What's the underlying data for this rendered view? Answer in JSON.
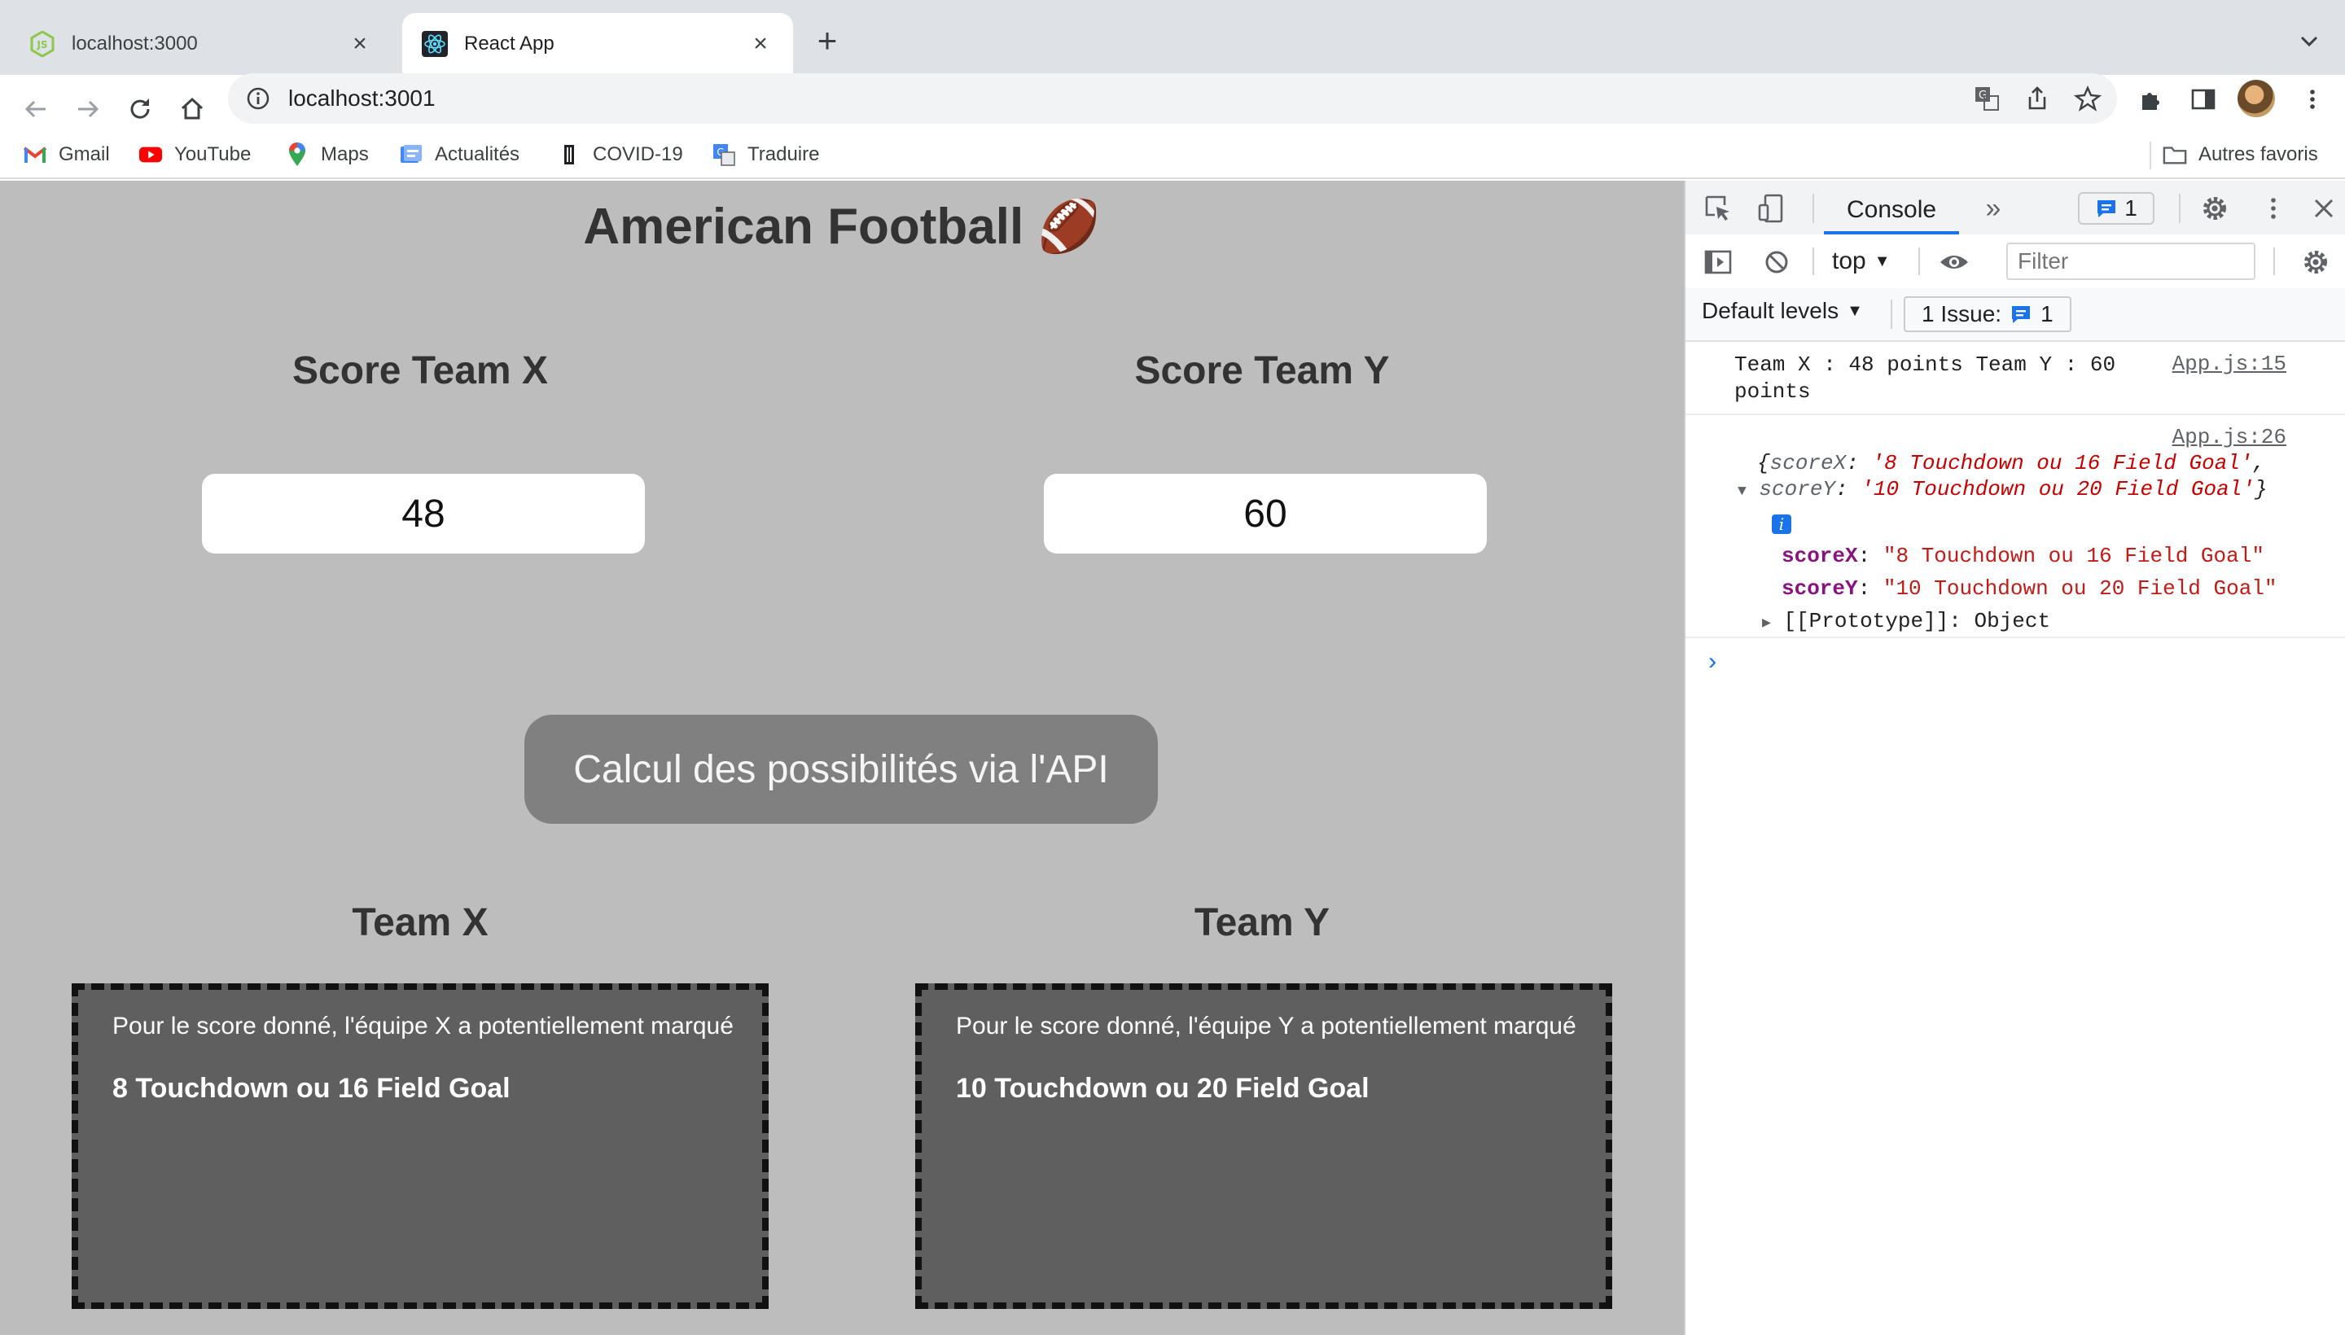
{
  "browser": {
    "tabs": [
      {
        "title": "localhost:3000",
        "icon": "nodejs-icon",
        "active": false
      },
      {
        "title": "React App",
        "icon": "react-icon",
        "active": true
      }
    ],
    "url": "localhost:3001",
    "bookmarks": [
      {
        "label": "Gmail",
        "icon": "gmail-icon"
      },
      {
        "label": "YouTube",
        "icon": "youtube-icon"
      },
      {
        "label": "Maps",
        "icon": "maps-icon"
      },
      {
        "label": "Actualités",
        "icon": "news-icon"
      },
      {
        "label": "COVID-19",
        "icon": "covid-icon"
      },
      {
        "label": "Traduire",
        "icon": "translate-icon"
      }
    ],
    "other_bookmarks": "Autres favoris"
  },
  "app": {
    "title": "American Football 🏈",
    "score_x_label": "Score Team X",
    "score_y_label": "Score Team Y",
    "score_x_value": "48",
    "score_y_value": "60",
    "button_label": "Calcul des possibilités via l'API",
    "team_x_label": "Team X",
    "team_y_label": "Team Y",
    "team_x_lead": "Pour le score donné, l'équipe X a potentiellement marqué",
    "team_y_lead": "Pour le score donné, l'équipe Y a potentiellement marqué",
    "team_x_result": "8 Touchdown ou 16 Field Goal",
    "team_y_result": "10 Touchdown ou 20 Field Goal"
  },
  "devtools": {
    "active_tab": "Console",
    "message_badge": "1",
    "context": "top",
    "filter_placeholder": "Filter",
    "levels": "Default levels",
    "issues_label": "1 Issue:",
    "issues_count": "1",
    "log1_line1": "Team X : 48 points  Team Y : 60",
    "log1_line2": "points",
    "log1_src": "App.js:15",
    "log2_src": "App.js:26",
    "obj_open": "{",
    "obj_key_x": "scoreX",
    "obj_val_x": "'8 Touchdown ou 16 Field Goal'",
    "obj_key_y": "scoreY",
    "obj_val_y": "'10 Touchdown ou 20 Field Goal'",
    "obj_close": "}",
    "prop_key_x": "scoreX",
    "prop_val_x": "\"8 Touchdown ou 16 Field Goal\"",
    "prop_key_y": "scoreY",
    "prop_val_y": "\"10 Touchdown ou 20 Field Goal\"",
    "proto_label": "[[Prototype]]: Object"
  }
}
